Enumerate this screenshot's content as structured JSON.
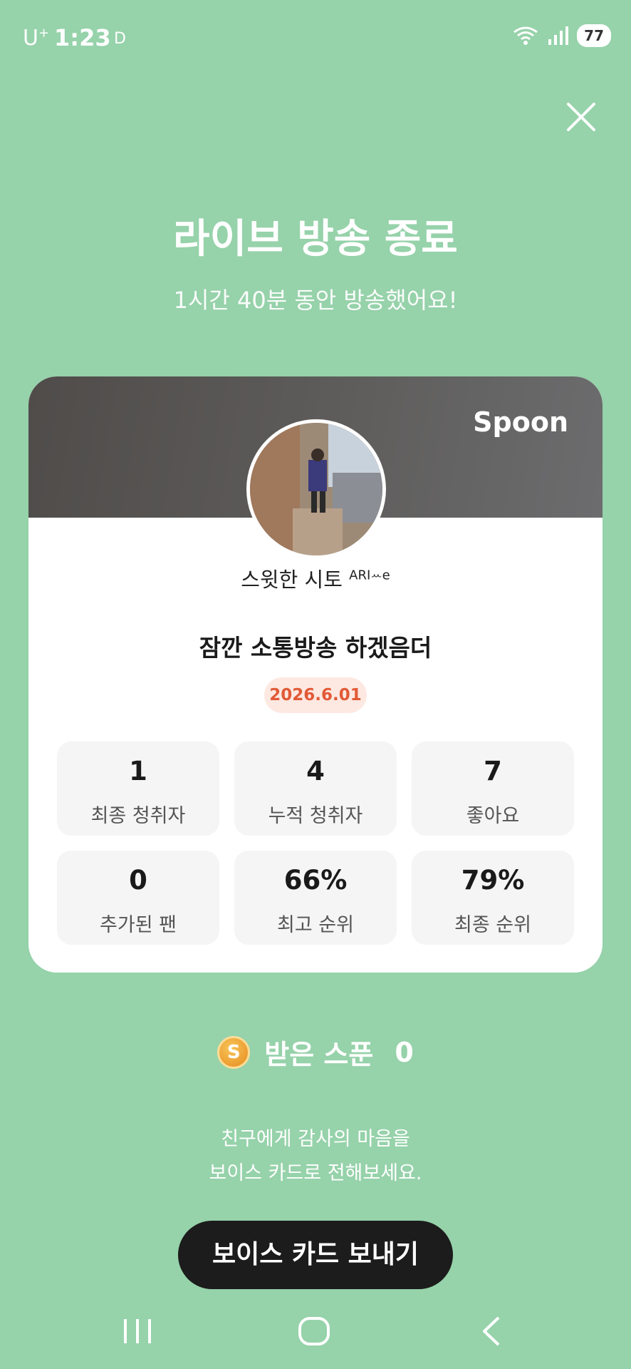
{
  "status_bar": {
    "carrier": "U",
    "carrier_sup": "+",
    "time": "1:23",
    "indicator": "D",
    "battery": "77"
  },
  "header": {
    "title": "라이브 방송 종료",
    "subtitle": "1시간 40분 동안 방송했어요!"
  },
  "card": {
    "brand": "Spoon",
    "nickname": "스윗한 시토",
    "nickname_sup": "ARI",
    "nickname_suffix": "ꕀe",
    "broadcast_title": "잠깐 소통방송 하겠음더",
    "date": "2026.6.01",
    "stats": [
      {
        "value": "1",
        "label": "최종 청취자"
      },
      {
        "value": "4",
        "label": "누적 청취자"
      },
      {
        "value": "7",
        "label": "좋아요"
      },
      {
        "value": "0",
        "label": "추가된 팬"
      },
      {
        "value": "66%",
        "label": "최고 순위"
      },
      {
        "value": "79%",
        "label": "최종 순위"
      }
    ]
  },
  "spoons": {
    "icon_letter": "S",
    "label": "받은 스푼",
    "count": "0"
  },
  "message": {
    "line1": "친구에게 감사의 마음을",
    "line2": "보이스 카드로 전해보세요."
  },
  "cta": {
    "label": "보이스 카드 보내기"
  },
  "icons": {
    "close": "close-icon",
    "recent_apps": "recent-apps-icon",
    "home": "home-icon",
    "back": "back-icon",
    "wifi": "wifi-icon",
    "signal": "signal-icon"
  },
  "colors": {
    "background": "#96d2aa",
    "date_accent": "#e15a36",
    "cta": "#1c1c1c"
  }
}
